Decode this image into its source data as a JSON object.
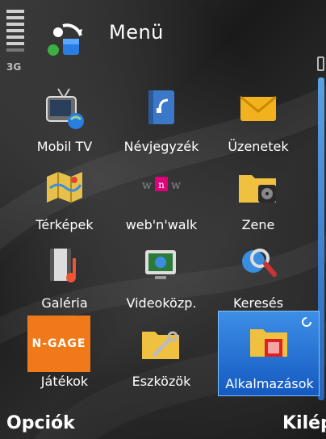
{
  "header": {
    "title": "Menü",
    "network": "3G"
  },
  "menu_items": [
    {
      "label": "Mobil TV",
      "icon": "tv-icon"
    },
    {
      "label": "Névjegyzék",
      "icon": "contacts-icon"
    },
    {
      "label": "Üzenetek",
      "icon": "envelope-icon"
    },
    {
      "label": "Térképek",
      "icon": "map-icon"
    },
    {
      "label": "web'n'walk",
      "icon": "webnwalk-icon"
    },
    {
      "label": "Zene",
      "icon": "music-folder-icon"
    },
    {
      "label": "Galéria",
      "icon": "gallery-icon"
    },
    {
      "label": "Videoközp.",
      "icon": "video-center-icon"
    },
    {
      "label": "Keresés",
      "icon": "search-icon"
    },
    {
      "label": "Játékok",
      "icon": "ngage-icon",
      "logo_text": "n-gage"
    },
    {
      "label": "Eszközök",
      "icon": "tools-folder-icon"
    },
    {
      "label": "Alkalmazások",
      "icon": "apps-folder-icon",
      "selected": true
    }
  ],
  "softkeys": {
    "left": "Opciók",
    "right": "Kilép"
  },
  "colors": {
    "selection": "#1f6fd6",
    "scrollbar": "#3b82d8"
  }
}
